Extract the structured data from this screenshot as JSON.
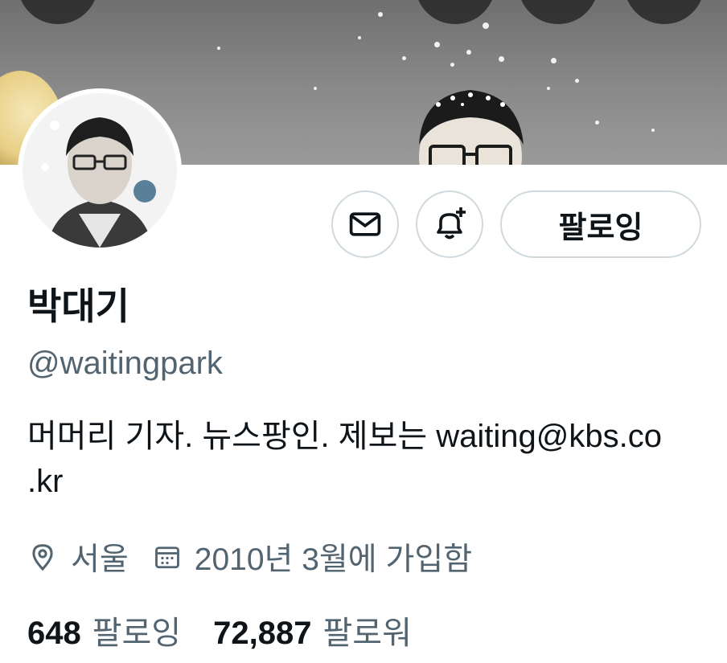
{
  "profile": {
    "display_name": "박대기",
    "handle": "@waitingpark",
    "bio_line1": "머머리 기자. 뉴스팡인. 제보는 waiting@kbs.co",
    "bio_line2": ".kr",
    "location": "서울",
    "joined": "2010년 3월에 가입함"
  },
  "actions": {
    "follow_label": "팔로잉"
  },
  "stats": {
    "following_count": "648",
    "following_label": "팔로잉",
    "followers_count": "72,887",
    "followers_label": "팔로워"
  },
  "icons": {
    "message": "envelope-icon",
    "notify": "bell-plus-icon",
    "location": "location-pin-icon",
    "joined": "calendar-icon"
  },
  "colors": {
    "text_primary": "#0f1419",
    "text_secondary": "#536471",
    "border": "#cfd9de"
  }
}
